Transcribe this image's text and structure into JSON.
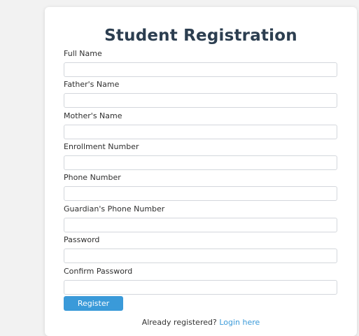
{
  "form": {
    "title": "Student Registration",
    "fields": [
      {
        "label": "Full Name",
        "value": "",
        "placeholder": ""
      },
      {
        "label": "Father's Name",
        "value": "",
        "placeholder": ""
      },
      {
        "label": "Mother's Name",
        "value": "",
        "placeholder": ""
      },
      {
        "label": "Enrollment Number",
        "value": "",
        "placeholder": ""
      },
      {
        "label": "Phone Number",
        "value": "",
        "placeholder": ""
      },
      {
        "label": "Guardian's Phone Number",
        "value": "",
        "placeholder": ""
      },
      {
        "label": "Password",
        "value": "",
        "placeholder": ""
      },
      {
        "label": "Confirm Password",
        "value": "",
        "placeholder": ""
      }
    ],
    "register_label": "Register",
    "login_prompt": "Already registered?",
    "login_link": "Login here"
  },
  "colors": {
    "accent": "#3a9ad9",
    "title": "#2c3e50",
    "background": "#f2f2f2"
  }
}
